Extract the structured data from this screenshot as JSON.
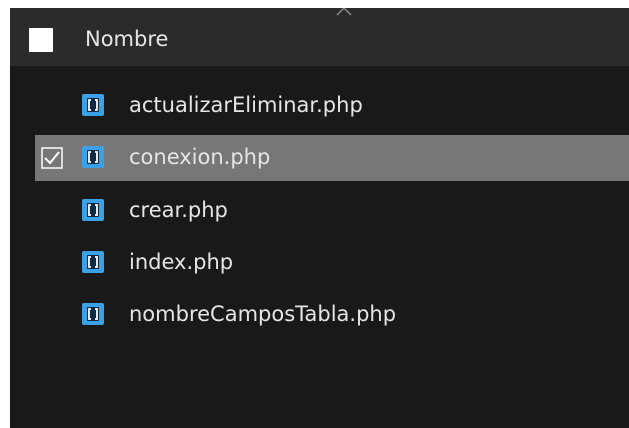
{
  "header": {
    "column_label": "Nombre",
    "sort_icon": "chevron-up-icon"
  },
  "files": [
    {
      "name": "actualizarEliminar.php",
      "icon": "php-file-icon",
      "selected": false
    },
    {
      "name": "conexion.php",
      "icon": "php-file-icon",
      "selected": true
    },
    {
      "name": "crear.php",
      "icon": "php-file-icon",
      "selected": false
    },
    {
      "name": "index.php",
      "icon": "php-file-icon",
      "selected": false
    },
    {
      "name": "nombreCamposTabla.php",
      "icon": "php-file-icon",
      "selected": false
    }
  ],
  "colors": {
    "panel_bg": "#191919",
    "header_bg": "#2b2b2b",
    "selected_row_bg": "#777777",
    "icon_blue": "#3aa0e8"
  }
}
